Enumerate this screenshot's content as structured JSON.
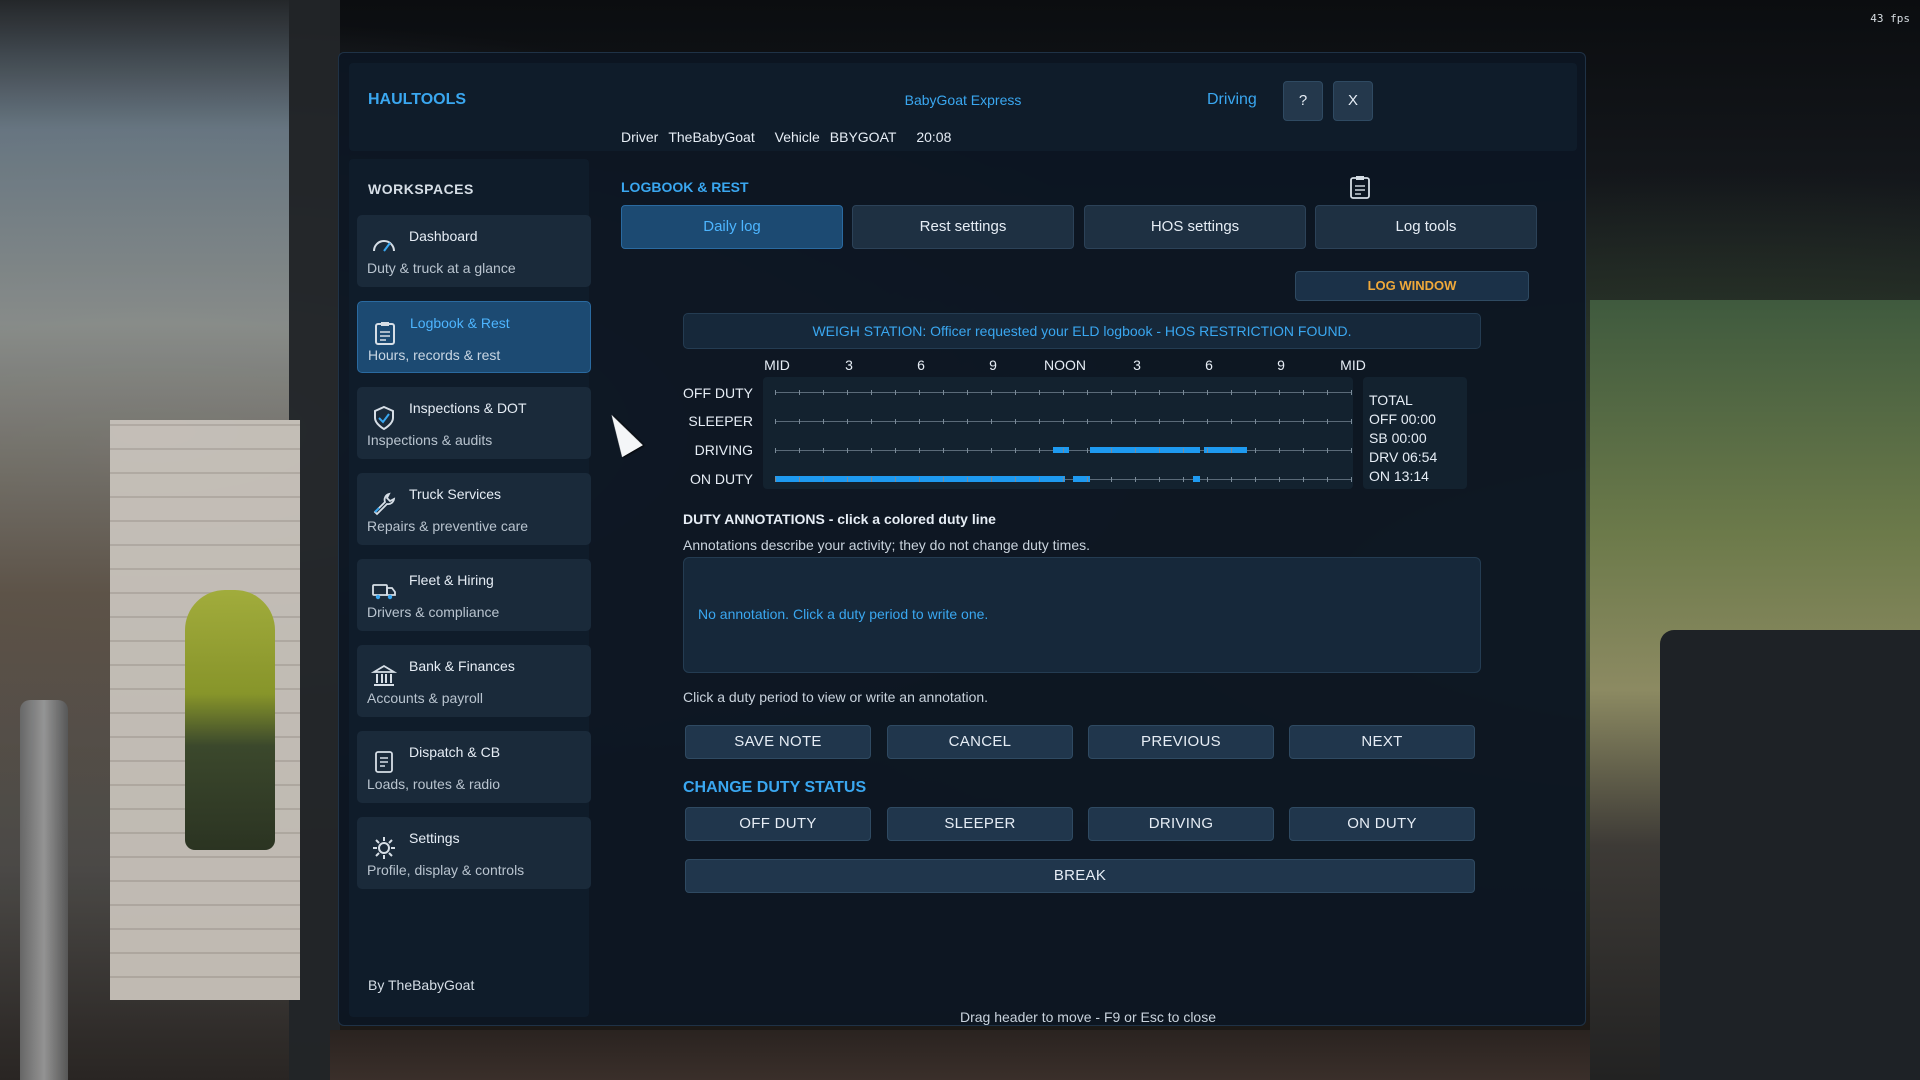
{
  "overlay": {
    "fps": "43 fps"
  },
  "header": {
    "app_title": "HAULTOOLS",
    "company": "BabyGoat Express",
    "driver_label": "Driver",
    "driver_name": "TheBabyGoat",
    "vehicle_label": "Vehicle",
    "vehicle_id": "BBYGOAT",
    "time": "20:08",
    "status": "Driving",
    "help_label": "?",
    "close_label": "X"
  },
  "sidebar": {
    "title": "WORKSPACES",
    "items": [
      {
        "label": "Dashboard",
        "sub": "Duty & truck at a glance",
        "icon": "gauge-icon"
      },
      {
        "label": "Logbook & Rest",
        "sub": "Hours, records & rest",
        "icon": "clipboard-icon",
        "active": true
      },
      {
        "label": "Inspections & DOT",
        "sub": "Inspections & audits",
        "icon": "shield-check-icon"
      },
      {
        "label": "Truck Services",
        "sub": "Repairs & preventive care",
        "icon": "wrench-icon"
      },
      {
        "label": "Fleet & Hiring",
        "sub": "Drivers & compliance",
        "icon": "truck-icon"
      },
      {
        "label": "Bank & Finances",
        "sub": "Accounts & payroll",
        "icon": "bank-icon"
      },
      {
        "label": "Dispatch & CB",
        "sub": "Loads, routes & radio",
        "icon": "document-icon"
      },
      {
        "label": "Settings",
        "sub": "Profile, display & controls",
        "icon": "gear-icon"
      }
    ],
    "byline": "By TheBabyGoat"
  },
  "main": {
    "title": "LOGBOOK & REST",
    "tabs": [
      {
        "label": "Daily log",
        "active": true
      },
      {
        "label": "Rest settings"
      },
      {
        "label": "HOS settings"
      },
      {
        "label": "Log tools"
      }
    ],
    "log_window_label": "LOG WINDOW",
    "alert": "WEIGH STATION: Officer requested your ELD logbook - HOS RESTRICTION FOUND.",
    "graph": {
      "hour_labels": [
        "MID",
        "3",
        "6",
        "9",
        "NOON",
        "3",
        "6",
        "9",
        "MID"
      ],
      "rows": [
        "OFF DUTY",
        "SLEEPER",
        "DRIVING",
        "ON DUTY"
      ],
      "totals": {
        "title": "TOTAL",
        "off": "OFF  00:00",
        "sb": "SB  00:00",
        "drv": "DRV  06:54",
        "on": "ON  13:14"
      }
    },
    "annotations": {
      "title": "DUTY ANNOTATIONS - click a colored duty line",
      "desc": "Annotations describe your activity; they do not change duty times.",
      "placeholder": "No annotation. Click a duty period to write one.",
      "hint": "Click a duty period to view or write an annotation."
    },
    "actions": {
      "save": "SAVE NOTE",
      "cancel": "CANCEL",
      "previous": "PREVIOUS",
      "next": "NEXT"
    },
    "change_duty_title": "CHANGE DUTY STATUS",
    "duty_buttons": {
      "off": "OFF DUTY",
      "sleeper": "SLEEPER",
      "driving": "DRIVING",
      "on": "ON DUTY",
      "break": "BREAK"
    },
    "footer": "Drag header to move - F9 or Esc to close"
  },
  "colors": {
    "accent": "#3aa7f0",
    "warning": "#f0a93a",
    "duty_line": "#1e9af0"
  }
}
